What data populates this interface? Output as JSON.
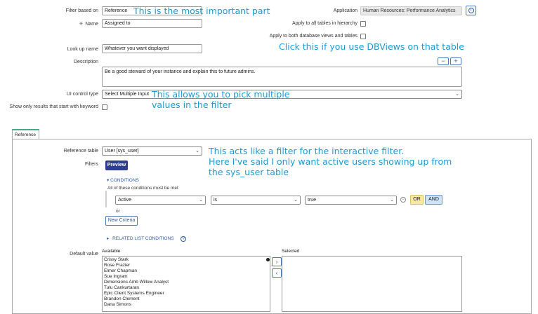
{
  "form": {
    "filter_based_on_label": "Filter based on",
    "filter_based_on_value": "Reference",
    "application_label": "Application",
    "application_value": "Human Resources: Performance Analytics",
    "name_label": "Name",
    "name_value": "Assigned to",
    "apply_hierarchy_label": "Apply to all tables in hierarchy",
    "apply_both_label": "Apply to both database views and tables",
    "lookup_label": "Look up name",
    "lookup_value": "Whatever you want displayed",
    "description_label": "Description",
    "description_value": "Be a good steward of your instance and explain this to future admins.",
    "ui_control_label": "UI control type",
    "ui_control_value": "Select Multiple Input",
    "show_only_label": "Show only results that start with keyword"
  },
  "annotations": {
    "most_important": "This is the most important part",
    "dbviews": "Click this if you use DBViews on that table",
    "multiple_1": "This allows you to pick multiple",
    "multiple_2": "values in the filter",
    "filter_1": "This acts like a filter for the interactive filter.",
    "filter_2": "Here I've said I only want active users showing up from",
    "filter_3": "the sys_user table"
  },
  "reference": {
    "tab_label": "Reference",
    "ref_table_label": "Reference table",
    "ref_table_value": "User [sys_user]",
    "filters_label": "Filters",
    "preview_label": "Preview",
    "conditions_label": "CONDITIONS",
    "all_conditions_text": "All of these conditions must be met",
    "field_value": "Active",
    "operator_value": "is",
    "value_value": "true",
    "or_label": "OR",
    "and_label": "AND",
    "or_text": "or",
    "new_criteria_label": "New Criteria",
    "related_label": "RELATED LIST CONDITIONS"
  },
  "default_value": {
    "label": "Default value",
    "available_label": "Available",
    "selected_label": "Selected",
    "available_items": [
      "Crissy Stark",
      "Rose Frazier",
      "Elmer Chapman",
      "Sue Ingram",
      "Dimensions Amb Willow Analyst",
      "Tulu Cankurtaran",
      "Epic Client Systems Engineer",
      "Brandon Clement",
      "Dana Simons"
    ]
  },
  "colors": {
    "annotation": "#1a9bd7",
    "preview_button": "#2f3d8f",
    "and_button": "#cde3f7",
    "or_button": "#f7e8a8"
  }
}
